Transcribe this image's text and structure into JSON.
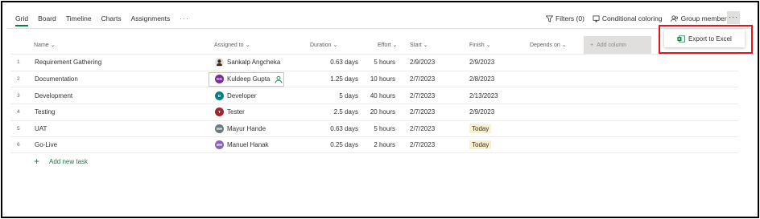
{
  "nav": {
    "tabs": [
      {
        "label": "Grid",
        "active": true
      },
      {
        "label": "Board"
      },
      {
        "label": "Timeline"
      },
      {
        "label": "Charts"
      },
      {
        "label": "Assignments"
      }
    ],
    "more": "···"
  },
  "toolbar": {
    "filters": "Filters (0)",
    "conditional_coloring": "Conditional coloring",
    "group_members": "Group members",
    "more": "···"
  },
  "export_menu": {
    "label": "Export to Excel",
    "icon": "excel-icon"
  },
  "grid": {
    "headers": {
      "name": "Name",
      "assigned": "Assigned to",
      "duration": "Duration",
      "effort": "Effort",
      "start": "Start",
      "finish": "Finish",
      "depends": "Depends on",
      "add_column": "Add column"
    },
    "rows": [
      {
        "num": "1",
        "name": "Requirement Gathering",
        "assignee": "Sankalp Angcheka",
        "initials": "",
        "avatar_color": "#3b2a20",
        "duration": "0.63 days",
        "effort": "5 hours",
        "start": "2/9/2023",
        "finish": "2/9/2023",
        "finish_today": false
      },
      {
        "num": "2",
        "name": "Documentation",
        "assignee": "Kuldeep Gupta",
        "initials": "KG",
        "avatar_color": "#7a2a9e",
        "duration": "1.25 days",
        "effort": "10 hours",
        "start": "2/7/2023",
        "finish": "2/8/2023",
        "finish_today": false
      },
      {
        "num": "3",
        "name": "Development",
        "assignee": "Developer",
        "initials": "D",
        "avatar_color": "#0b7f7f",
        "duration": "5 days",
        "effort": "40 hours",
        "start": "2/7/2023",
        "finish": "2/13/2023",
        "finish_today": false
      },
      {
        "num": "4",
        "name": "Testing",
        "assignee": "Tester",
        "initials": "T",
        "avatar_color": "#a4262c",
        "duration": "2.5 days",
        "effort": "20 hours",
        "start": "2/7/2023",
        "finish": "2/9/2023",
        "finish_today": false
      },
      {
        "num": "5",
        "name": "UAT",
        "assignee": "Mayur Hande",
        "initials": "MH",
        "avatar_color": "#69797e",
        "duration": "0.63 days",
        "effort": "5 hours",
        "start": "2/7/2023",
        "finish": "Today",
        "finish_today": true
      },
      {
        "num": "6",
        "name": "Go-Live",
        "assignee": "Manuel Hanak",
        "initials": "MH",
        "avatar_color": "#8764b8",
        "duration": "0.25 days",
        "effort": "2 hours",
        "start": "2/7/2023",
        "finish": "Today",
        "finish_today": true
      }
    ],
    "add_task": "Add new task"
  },
  "colors": {
    "accent": "#107c41",
    "highlight": "#e8131f",
    "today_bg": "#fdf0c9"
  }
}
